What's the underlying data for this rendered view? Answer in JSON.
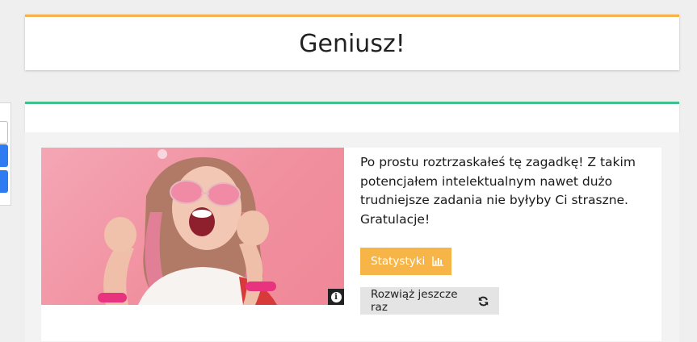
{
  "title": "Geniusz!",
  "result": {
    "message": "Po prostu roztrzaskałeś tę zagadkę! Z takim potencjałem intelektualnym nawet dużo trudniejsze zadania nie byłyby Ci straszne. Gratulacje!",
    "stats_label": "Statystyki",
    "retry_label": "Rozwiąż jeszcze raz",
    "info_badge": "i"
  },
  "icons": {
    "stats": "bar-chart-icon",
    "retry": "refresh-icon",
    "info": "info-icon"
  },
  "colors": {
    "title_accent": "#f6b24b",
    "result_accent": "#41c08e",
    "stats_button": "#f8b547",
    "retry_button": "#e4e4e4",
    "left_buttons": "#2f7bf1"
  }
}
